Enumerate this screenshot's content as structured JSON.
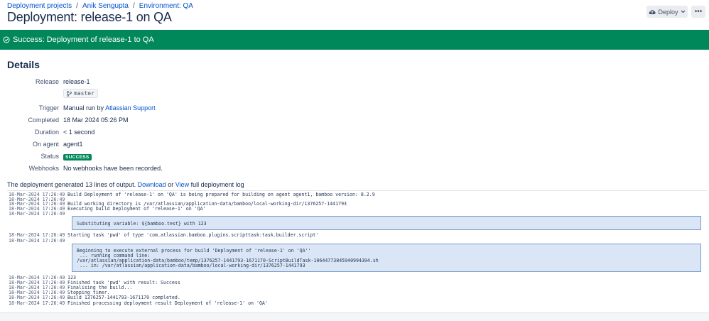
{
  "breadcrumb": {
    "items": [
      "Deployment projects",
      "Anik Sengupta",
      "Environment: QA"
    ],
    "separator": "/"
  },
  "page_title": "Deployment: release-1 on QA",
  "toolbar": {
    "deploy_label": "Deploy",
    "more_label": "•••"
  },
  "banner": {
    "text": "Success: Deployment of release-1 to QA",
    "color": "#00875a"
  },
  "details": {
    "title": "Details",
    "release_label": "Release",
    "release_value": "release-1",
    "branch": "master",
    "trigger_label": "Trigger",
    "trigger_prefix": "Manual run by",
    "trigger_user": "Atlassian Support",
    "completed_label": "Completed",
    "completed_value": "18 Mar 2024 05:26 PM",
    "duration_label": "Duration",
    "duration_value": "< 1 second",
    "agent_label": "On agent",
    "agent_value": "agent1",
    "status_label": "Status",
    "status_value": "SUCCESS",
    "webhooks_label": "Webhooks",
    "webhooks_value": "No webhooks have been recorded."
  },
  "log_summary": {
    "prefix": "The deployment generated 13 lines of output.",
    "download": "Download",
    "or": "or",
    "view": "View",
    "suffix": "full deployment log"
  },
  "log": {
    "lines": [
      {
        "ts": "18-Mar-2024 17:26:49",
        "msg": "Build Deployment of 'release-1' on 'QA' is being prepared for building on agent agent1, bamboo version: 8.2.9"
      },
      {
        "ts": "18-Mar-2024 17:26:49",
        "msg": ""
      },
      {
        "ts": "18-Mar-2024 17:26:49",
        "msg": "Build working directory is /var/atlassian/application-data/bamboo/local-working-dir/1376257-1441793"
      },
      {
        "ts": "18-Mar-2024 17:26:49",
        "msg": "Executing build Deployment of 'release-1' on 'QA'"
      },
      {
        "ts": "18-Mar-2024 17:26:49",
        "msg": ""
      },
      {
        "ts": "18-Mar-2024 17:26:49",
        "msg": "Starting task 'pwd' of type 'com.atlassian.bamboo.plugins.scripttask:task.builder.script'"
      },
      {
        "ts": "18-Mar-2024 17:26:49",
        "msg": ""
      },
      {
        "ts": "18-Mar-2024 17:26:49",
        "msg": "123"
      },
      {
        "ts": "18-Mar-2024 17:26:49",
        "msg": "Finished task 'pwd' with result: Success"
      },
      {
        "ts": "18-Mar-2024 17:26:49",
        "msg": "Finalising the build..."
      },
      {
        "ts": "18-Mar-2024 17:26:49",
        "msg": "Stopping timer."
      },
      {
        "ts": "18-Mar-2024 17:26:49",
        "msg": "Build 1376257-1441793-1671170 completed."
      },
      {
        "ts": "18-Mar-2024 17:26:49",
        "msg": "Finished processing deployment result Deployment of 'release-1' on 'QA'"
      }
    ],
    "box1": [
      "Substituting variable: ${bamboo.test} with 123"
    ],
    "box2": [
      "Beginning to execute external process for build 'Deployment of 'release-1' on 'QA''",
      " ... running command line:",
      "/var/atlassian/application-data/bamboo/temp/1376257-1441793-1671170-ScriptBuildTask-10644773845940994394.sh",
      " ... in: /var/atlassian/application-data/bamboo/local-working-dir/1376257-1441793"
    ]
  }
}
